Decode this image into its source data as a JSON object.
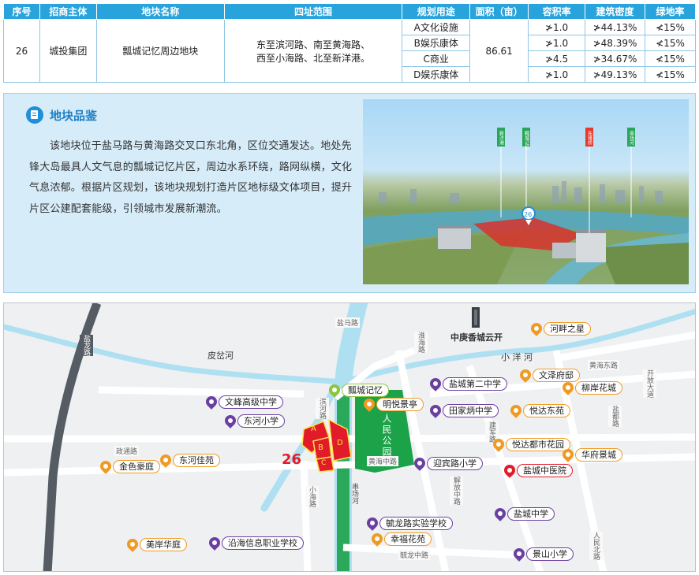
{
  "table": {
    "headers": [
      "序号",
      "招商主体",
      "地块名称",
      "四址范围",
      "规划用途",
      "面积（亩）",
      "容积率",
      "建筑密度",
      "绿地率"
    ],
    "row": {
      "no": "26",
      "entity": "城投集团",
      "name": "瓢城记忆周边地块",
      "bounds_line1": "东至滨河路、南至黄海路、",
      "bounds_line2": "西至小海路、北至新洋港。",
      "area": "86.61"
    },
    "subrows": [
      {
        "use": "A文化设施",
        "far": "≯1.0",
        "density": "≯44.13%",
        "green": "≮15%"
      },
      {
        "use": "B娱乐康体",
        "far": "≯1.0",
        "density": "≯48.39%",
        "green": "≮15%"
      },
      {
        "use": "C商业",
        "far": "≯4.5",
        "density": "≯34.67%",
        "green": "≮15%"
      },
      {
        "use": "D娱乐康体",
        "far": "≯1.0",
        "density": "≯49.13%",
        "green": "≮15%"
      }
    ]
  },
  "panel": {
    "title": "地块品鉴",
    "text": "该地块位于盐马路与黄海路交叉口东北角，区位交通发达。地处先锋大岛最具人文气息的瓢城记忆片区，周边水系环绕，路网纵横，文化气息浓郁。根据片区规划，该地块规划打造片区地标级文体项目，提升片区公建配套能级，引领城市发展新潮流。",
    "photo_tags": [
      "新洋港",
      "瓢城记忆",
      "先锋桥",
      "串场河"
    ],
    "photo_marker": "26"
  },
  "map": {
    "plot_number": "26",
    "plot_parts": [
      "A",
      "B",
      "C",
      "D"
    ],
    "rivers": {
      "pidian": "皮岔河",
      "xiaoyang": "小 洋 河",
      "chuanchang": "串场河"
    },
    "roads": {
      "yanma": "盐马路",
      "yanmaroad2": "盐马路",
      "binhe": "滨河路",
      "yanlong": "盐龙路",
      "huaihai": "淮海路",
      "zhengyuan": "政通路",
      "xiaohai": "小海路",
      "huanghai": "黄海中路",
      "jiefang": "解放中路",
      "jianjun": "建军路",
      "huanghai_e": "黄海东路",
      "kaifang": "开放大道",
      "yingbin": "迎宾路",
      "renmin": "人民北路",
      "jianjun2": "建军中路",
      "yulong": "毓龙中路",
      "yandu": "盐都路",
      "yanchu": "盐城路"
    },
    "landmark_zhongfang": "中庚香城云开",
    "park_label": "人民公园",
    "pois": [
      {
        "id": "pcjy",
        "label": "瓢城记忆",
        "color": "green"
      },
      {
        "id": "wfgz",
        "label": "文峰高级中学",
        "color": "purple"
      },
      {
        "id": "dhxx",
        "label": "东河小学",
        "color": "purple"
      },
      {
        "id": "mylt",
        "label": "明悦景亭",
        "color": "orange"
      },
      {
        "id": "jshj",
        "label": "金色豪庭",
        "color": "orange"
      },
      {
        "id": "dhjy",
        "label": "东河佳苑",
        "color": "orange"
      },
      {
        "id": "ycde",
        "label": "盐城第二中学",
        "color": "purple"
      },
      {
        "id": "tjbz",
        "label": "田家炳中学",
        "color": "purple"
      },
      {
        "id": "hpzx",
        "label": "河畔之星",
        "color": "orange"
      },
      {
        "id": "wzfd",
        "label": "文泽府邸",
        "color": "orange"
      },
      {
        "id": "lahc",
        "label": "柳岸花城",
        "color": "orange"
      },
      {
        "id": "ydwy",
        "label": "悦达东苑",
        "color": "orange"
      },
      {
        "id": "ydds",
        "label": "悦达都市花园",
        "color": "orange"
      },
      {
        "id": "hfjc",
        "label": "华府景城",
        "color": "orange"
      },
      {
        "id": "ybxx",
        "label": "迎宾路小学",
        "color": "purple"
      },
      {
        "id": "yczy",
        "label": "盐城中医院",
        "color": "red"
      },
      {
        "id": "yczx",
        "label": "盐城中学",
        "color": "purple"
      },
      {
        "id": "ylsy",
        "label": "毓龙路实验学校",
        "color": "purple"
      },
      {
        "id": "xfhy",
        "label": "幸福花苑",
        "color": "orange"
      },
      {
        "id": "mahl",
        "label": "美岸华庭",
        "color": "orange"
      },
      {
        "id": "yhxx",
        "label": "沿海信息职业学校",
        "color": "purple"
      },
      {
        "id": "jsxx",
        "label": "景山小学",
        "color": "purple"
      }
    ]
  }
}
